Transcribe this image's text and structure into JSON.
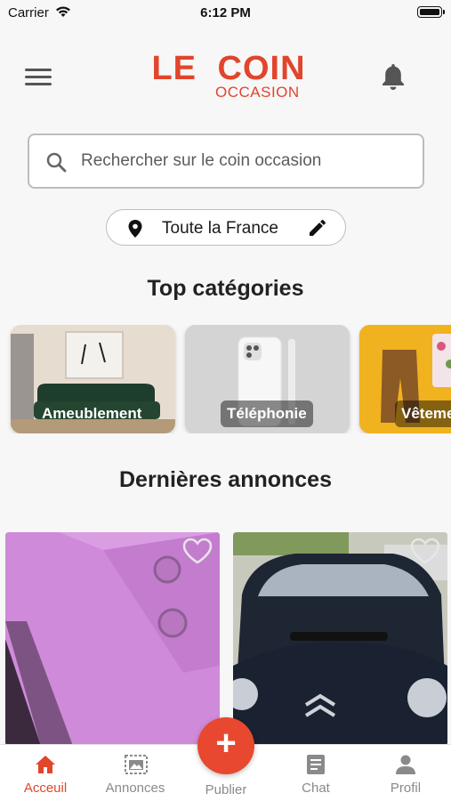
{
  "status": {
    "carrier": "Carrier",
    "time": "6:12 PM"
  },
  "header": {
    "logo_main": "LE COIN",
    "logo_sub": "OCCASION",
    "search_placeholder": "Rechercher sur le coin occasion"
  },
  "location": {
    "label": "Toute la France"
  },
  "sections": {
    "top_categories": "Top catégories",
    "latest_ads": "Dernières annonces"
  },
  "categories": [
    {
      "label": "Ameublement"
    },
    {
      "label": "Téléphonie"
    },
    {
      "label": "Vêteme"
    }
  ],
  "tabs": {
    "home": "Acceuil",
    "ads": "Annonces",
    "publish": "Publier",
    "chat": "Chat",
    "profile": "Profil"
  },
  "colors": {
    "accent": "#e1452b",
    "tab_inactive": "#8a8a8a"
  },
  "icons": [
    "menu-icon",
    "bell-icon",
    "search-icon",
    "pin-icon",
    "pencil-icon",
    "heart-icon",
    "home-icon",
    "ads-icon",
    "plus-icon",
    "chat-icon",
    "profile-icon"
  ]
}
